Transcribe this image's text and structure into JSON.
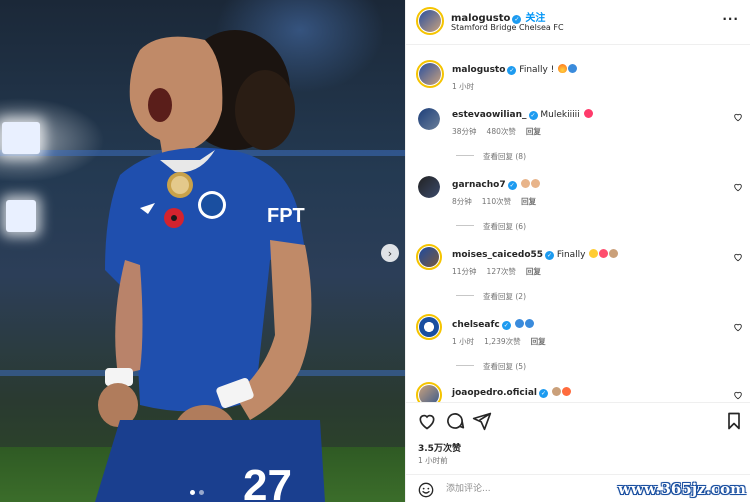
{
  "post": {
    "username": "malogusto",
    "follow_label": "关注",
    "location": "Stamford Bridge Chelsea FC",
    "caption_username": "malogusto",
    "caption_text": "Finally ! ",
    "caption_time": "1 小时"
  },
  "comments": [
    {
      "username": "estevaowilian_",
      "text": "Mulekiiiii ",
      "time": "38分钟",
      "likes": "480次赞",
      "reply_label": "回复",
      "view_replies": "查看回复 (8)"
    },
    {
      "username": "garnacho7",
      "text": "",
      "time": "8分钟",
      "likes": "110次赞",
      "reply_label": "回复",
      "view_replies": "查看回复 (6)"
    },
    {
      "username": "moises_caicedo55",
      "text": "Finally ",
      "time": "11分钟",
      "likes": "127次赞",
      "reply_label": "回复",
      "view_replies": "查看回复 (2)"
    },
    {
      "username": "chelseafc",
      "text": "",
      "time": "1 小时",
      "likes": "1,239次赞",
      "reply_label": "回复",
      "view_replies": "查看回复 (5)"
    },
    {
      "username": "joaopedro.oficial",
      "text": ""
    }
  ],
  "stats": {
    "likes": "3.5万次赞",
    "time": "1 小时前"
  },
  "add_comment": {
    "placeholder": "添加评论..."
  },
  "photo": {
    "jersey_number": "27",
    "sponsor": "FPT"
  },
  "watermark": "www.365jz.com",
  "icons": [
    "heart-icon",
    "comment-icon",
    "share-icon",
    "bookmark-icon",
    "more-icon",
    "smile-icon",
    "chevron-right-icon",
    "verified-icon",
    "fire-emoji",
    "blue-heart-emoji",
    "pink-heart-emoji",
    "raised-hands-emoji",
    "heart-eyes-emoji"
  ],
  "colors": {
    "accent": "#0095f6",
    "verified": "#1d9bf0",
    "chelsea_blue": "#1a4fa0"
  }
}
